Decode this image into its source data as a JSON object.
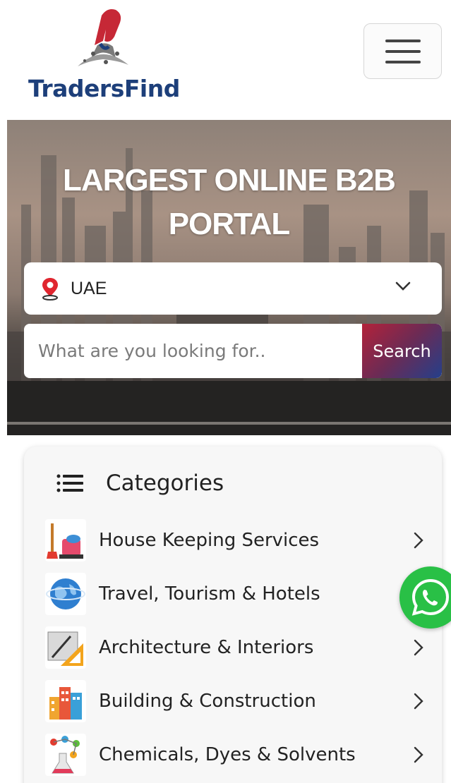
{
  "header": {
    "logo_text": "TradersFind",
    "menu_icon": "hamburger-menu-icon"
  },
  "hero": {
    "title": "LARGEST ONLINE B2B PORTAL",
    "location": {
      "icon": "map-pin-icon",
      "selected": "UAE",
      "dropdown_icon": "chevron-down-icon"
    },
    "search": {
      "placeholder": "What are you looking for..",
      "button_label": "Search"
    }
  },
  "categories": {
    "title": "Categories",
    "icon": "list-icon",
    "items": [
      {
        "label": "House Keeping Services",
        "icon": "housekeeping-icon"
      },
      {
        "label": "Travel, Tourism & Hotels",
        "icon": "globe-travel-icon"
      },
      {
        "label": "Architecture & Interiors",
        "icon": "architecture-icon"
      },
      {
        "label": "Building & Construction",
        "icon": "building-icon"
      },
      {
        "label": "Chemicals, Dyes & Solvents",
        "icon": "chemicals-icon"
      }
    ]
  },
  "floating": {
    "whatsapp_icon": "whatsapp-icon"
  },
  "colors": {
    "brand_blue": "#1d3f7a",
    "brand_red": "#c62836",
    "whatsapp_green": "#29c046"
  }
}
